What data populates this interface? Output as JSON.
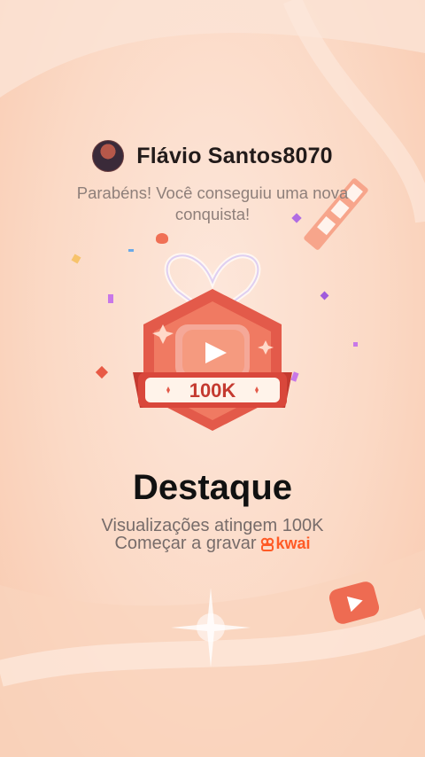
{
  "user": {
    "name": "Flávio Santos8070",
    "avatar_icon": "user-avatar-photo"
  },
  "message": {
    "congrats": "Parabéns! Você conseguiu uma nova conquista!"
  },
  "badge": {
    "label": "100K",
    "icon": "play-icon",
    "primary_color": "#e35a4a",
    "ribbon_color": "#d9473b"
  },
  "achievement": {
    "title": "Destaque",
    "description": "Visualizações atingem 100K",
    "cta": "Começar a gravar",
    "brand": "kwai",
    "brand_color": "#ff5b26"
  }
}
